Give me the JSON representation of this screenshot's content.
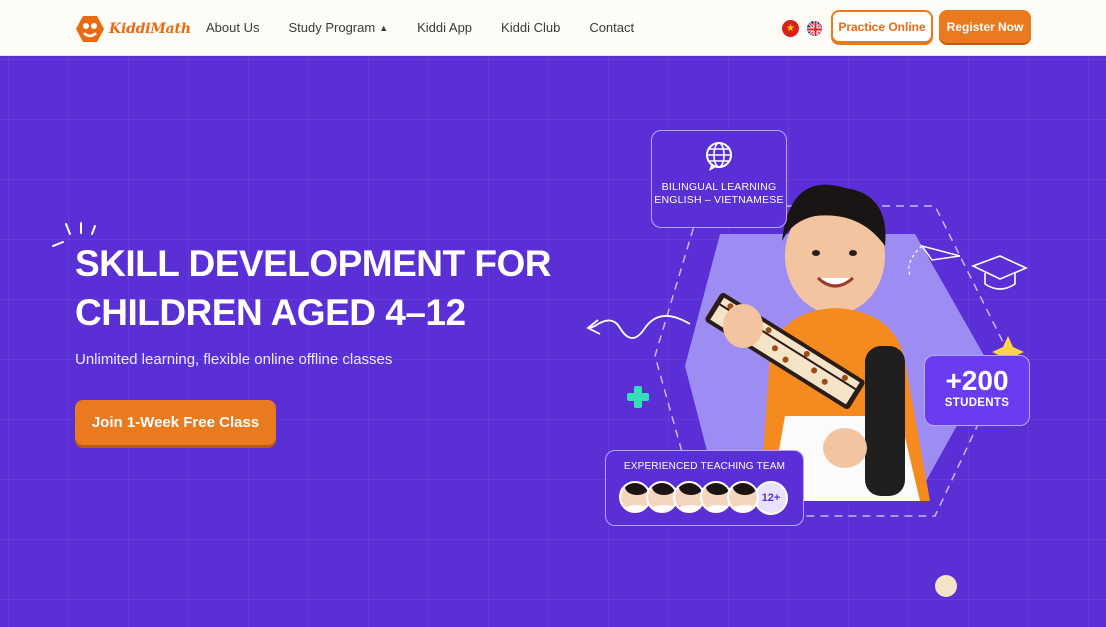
{
  "header": {
    "logo_text": "KiddiMath",
    "nav": [
      {
        "label": "About Us"
      },
      {
        "label": "Study Program",
        "has_dropdown": true
      },
      {
        "label": "Kiddi App"
      },
      {
        "label": "Kiddi Club"
      },
      {
        "label": "Contact"
      }
    ],
    "languages": [
      "vn-flag-icon",
      "uk-flag-icon"
    ],
    "practice_label": "Practice Online",
    "register_label": "Register Now"
  },
  "hero": {
    "title": "SKILL DEVELOPMENT FOR CHILDREN AGED 4–12",
    "subtitle": "Unlimited learning, flexible online offline classes",
    "cta_label": "Join 1-Week Free Class"
  },
  "cards": {
    "bilingual": "BILINGUAL LEARNING ENGLISH – VIETNAMESE",
    "students_count": "+200",
    "students_label": "STUDENTS",
    "team_label": "EXPERIENCED TEACHING TEAM",
    "team_more": "12+"
  },
  "colors": {
    "brand_orange": "#ea7a1f",
    "hero_purple": "#5a2fd6",
    "header_bg": "#fdfcf6"
  }
}
